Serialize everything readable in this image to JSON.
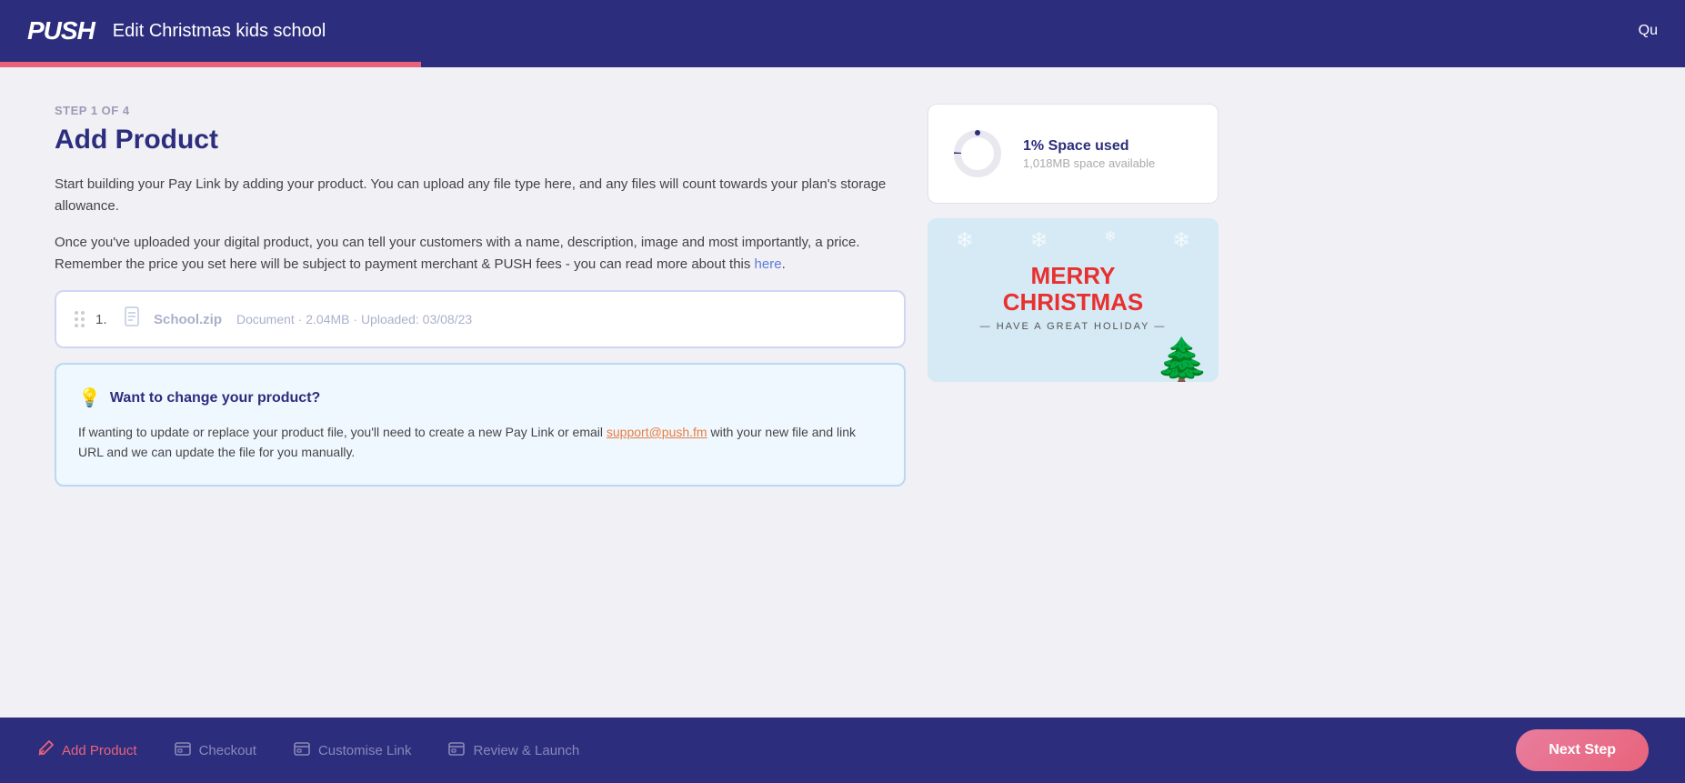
{
  "header": {
    "logo": "PUSH",
    "title": "Edit Christmas kids school",
    "quit_label": "Qu"
  },
  "progress": {
    "fill_percent": 25
  },
  "main": {
    "step_label": "STEP 1 OF 4",
    "page_title": "Add Product",
    "description_1": "Start building your Pay Link by adding your product. You can upload any file type here, and any files will count towards your plan's storage allowance.",
    "description_2_before": "Once you've uploaded your digital product, you can tell your customers with a name, description, image and most importantly, a price. Remember the price you set here will be subject to payment merchant & PUSH fees - you can read more about this ",
    "description_2_link": "here",
    "description_2_after": ".",
    "file": {
      "number": "1.",
      "name": "School.zip",
      "meta": "Document · 2.04MB · Uploaded: 03/08/23"
    },
    "info_box": {
      "title": "Want to change your product?",
      "text_before": "If wanting to update or replace your product file, you'll need to create a new Pay Link or email ",
      "email": "support@push.fm",
      "text_after": " with your new file and link URL and we can update the file for you manually."
    }
  },
  "right_panel": {
    "space_used_label": "1% Space used",
    "space_available": "1,018MB space available",
    "christmas_merry": "MERRY",
    "christmas_christmas": "CHRISTMAS",
    "christmas_divider": "— HAVE A GREAT HOLIDAY —"
  },
  "footer": {
    "nav_items": [
      {
        "id": "add-product",
        "icon": "✏️",
        "label": "Add Product",
        "active": true
      },
      {
        "id": "checkout",
        "icon": "💬",
        "label": "Checkout",
        "active": false
      },
      {
        "id": "customise-link",
        "icon": "💬",
        "label": "Customise Link",
        "active": false
      },
      {
        "id": "review-launch",
        "icon": "💬",
        "label": "Review & Launch",
        "active": false
      }
    ],
    "next_step_label": "Next Step"
  }
}
